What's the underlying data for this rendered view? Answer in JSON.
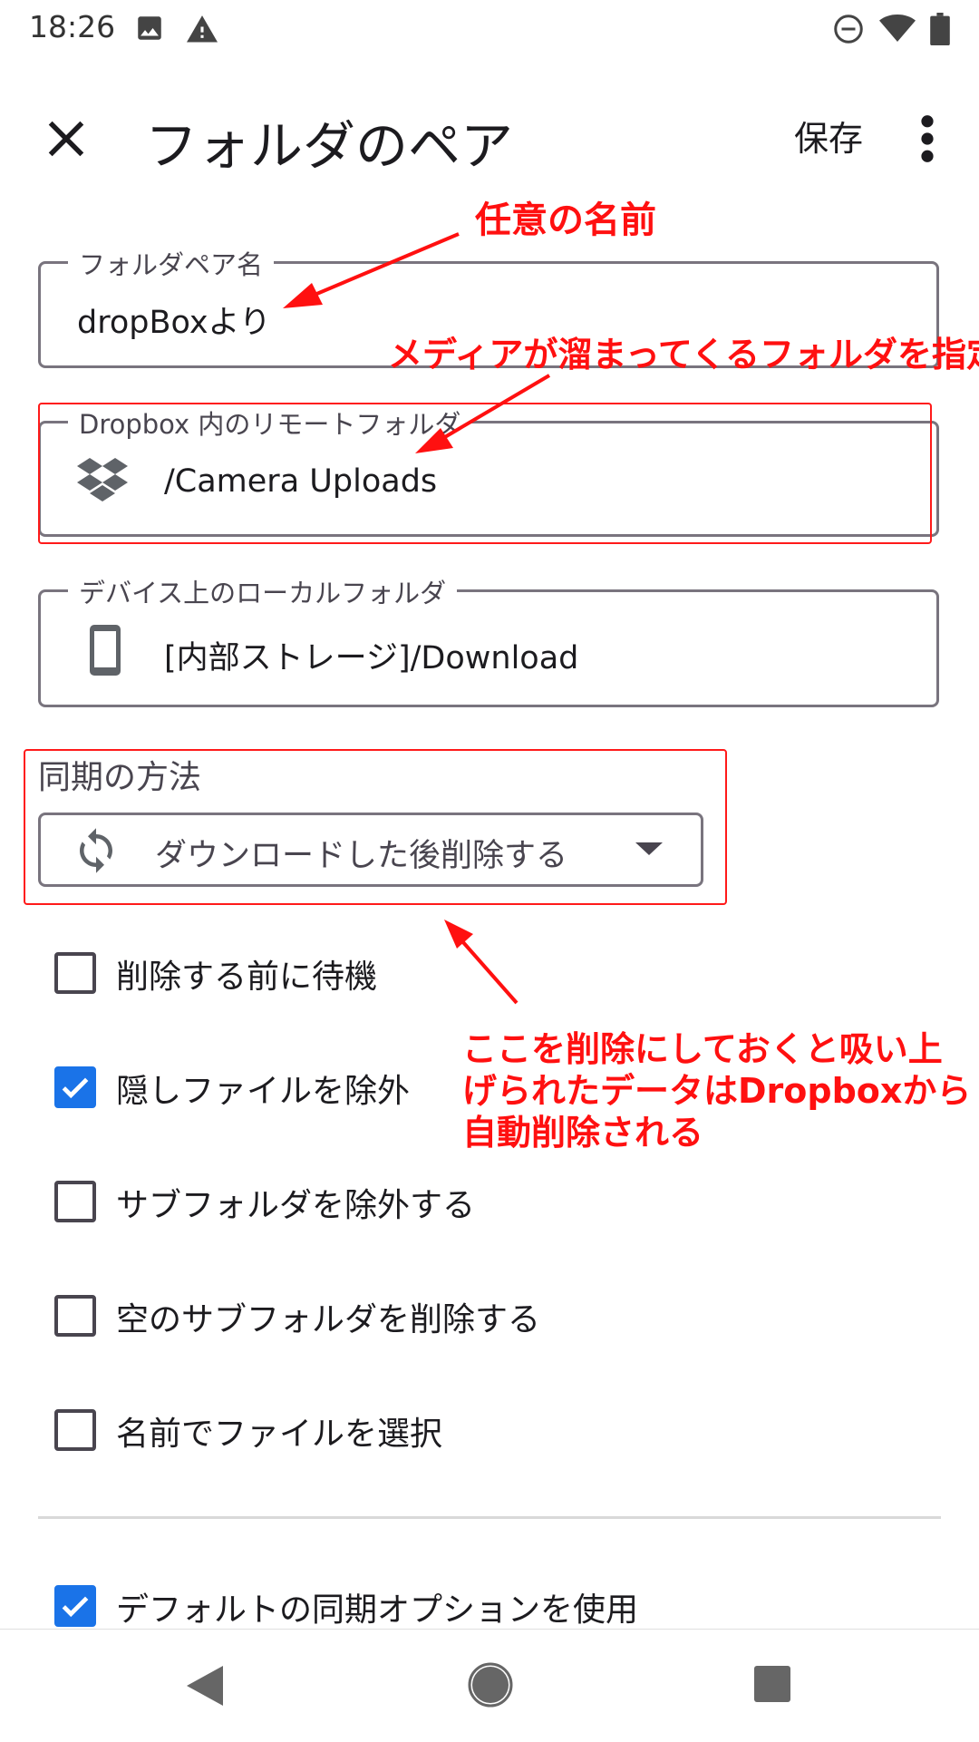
{
  "status_bar": {
    "time": "18:26",
    "left_icons": [
      "image-icon",
      "warning-icon"
    ],
    "right_icons": [
      "do-not-disturb-icon",
      "wifi-icon",
      "battery-icon"
    ]
  },
  "appbar": {
    "title": "フォルダのペア",
    "save_label": "保存",
    "close_icon": "close-icon",
    "more_icon": "more-vert-icon"
  },
  "fields": {
    "pair_name": {
      "label": "フォルダペア名",
      "value": "dropBoxより"
    },
    "remote": {
      "label": "Dropbox 内のリモートフォルダ",
      "value": "/Camera Uploads",
      "icon": "dropbox-icon"
    },
    "local": {
      "label": "デバイス上のローカルフォルダ",
      "value": "[内部ストレージ]/Download",
      "icon": "phone-icon"
    }
  },
  "sync_method": {
    "label": "同期の方法",
    "value": "ダウンロードした後削除する",
    "icon": "sync-icon",
    "dropdown_icon": "arrow-drop-down-icon"
  },
  "options": [
    {
      "label": "削除する前に待機",
      "checked": false
    },
    {
      "label": "隠しファイルを除外",
      "checked": true
    },
    {
      "label": "サブフォルダを除外する",
      "checked": false
    },
    {
      "label": "空のサブフォルダを削除する",
      "checked": false
    },
    {
      "label": "名前でファイルを選択",
      "checked": false
    },
    {
      "label": "デフォルトの同期オプションを使用",
      "checked": true
    }
  ],
  "annotations": {
    "name_note": "任意の名前",
    "remote_note": "メディアが溜まってくるフォルダを指定",
    "sync_note_line1": "ここを削除にしておくと吸い上",
    "sync_note_line2": "げられたデータはDropboxから",
    "sync_note_line3": "自動削除される"
  },
  "nav": {
    "icons": [
      "back-icon",
      "home-icon",
      "recents-icon"
    ]
  },
  "colors": {
    "accent": "#1a73e8",
    "annotation": "#ff1010",
    "outline": "#79747e"
  }
}
